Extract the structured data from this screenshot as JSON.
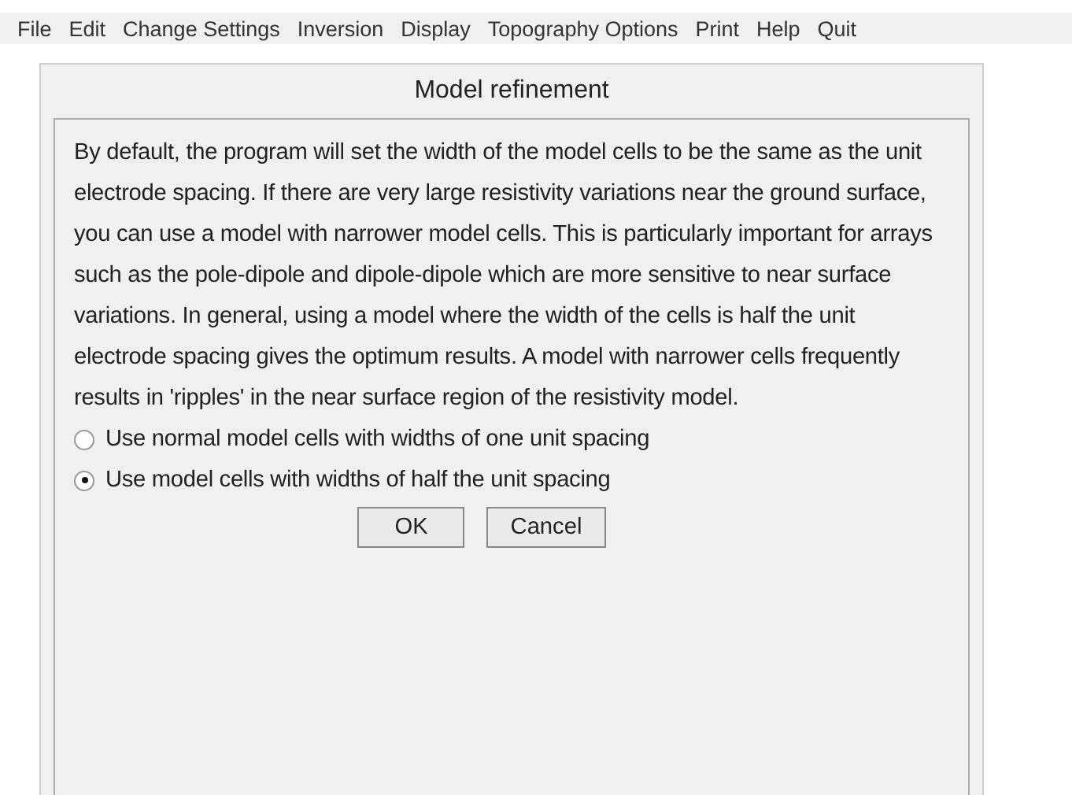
{
  "menu": [
    "File",
    "Edit",
    "Change Settings",
    "Inversion",
    "Display",
    "Topography Options",
    "Print",
    "Help",
    "Quit"
  ],
  "dialog": {
    "title": "Model refinement",
    "description": "By default, the program will set the width of the model cells to be the same as the unit electrode spacing. If there are very large resistivity variations near the ground surface, you can use a model with narrower model cells. This is particularly important for arrays such as the pole-dipole and dipole-dipole which are more sensitive to near surface variations. In general, using a model where the width of the cells is half the unit electrode spacing gives the optimum results. A model with narrower cells frequently results in 'ripples' in the near surface region of the resistivity model.",
    "options": [
      {
        "label": "Use normal model cells with widths of one unit spacing",
        "selected": false
      },
      {
        "label": "Use model cells with widths of half the unit spacing",
        "selected": true
      }
    ],
    "buttons": [
      "OK",
      "Cancel"
    ]
  }
}
